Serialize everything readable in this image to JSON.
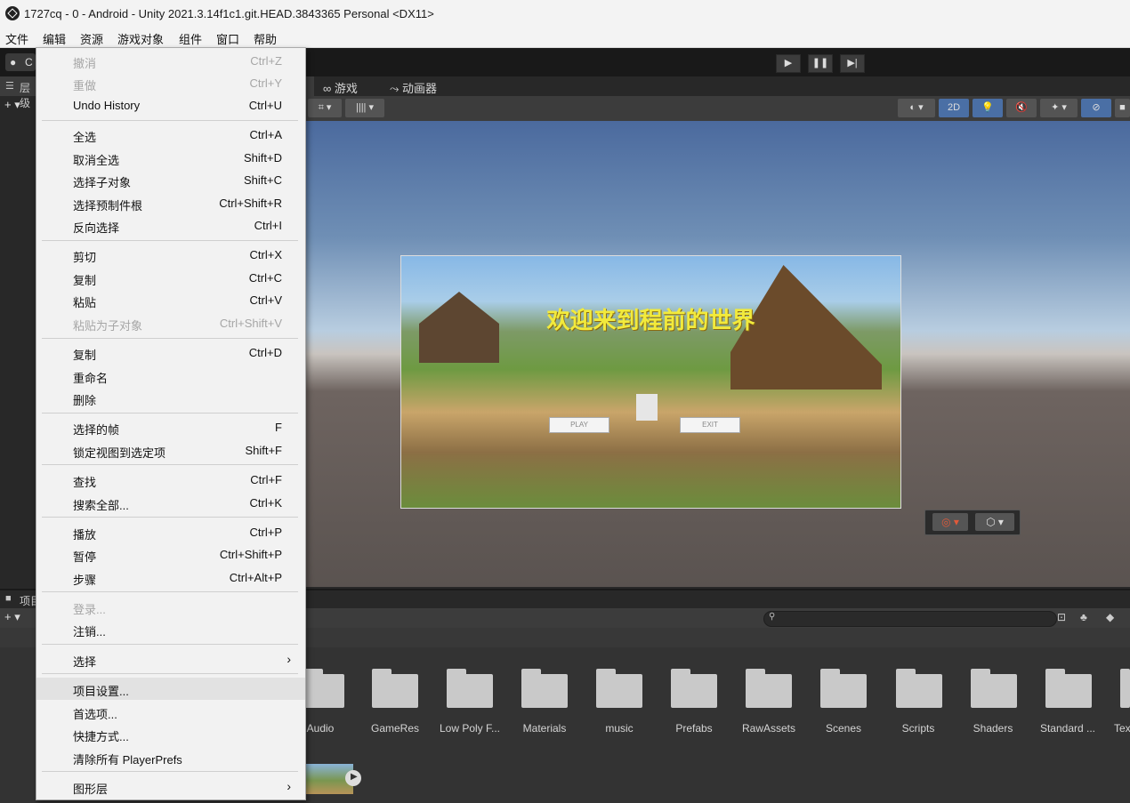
{
  "window": {
    "title": "1727cq - 0 - Android - Unity 2021.3.14f1c1.git.HEAD.3843365 Personal <DX11>"
  },
  "menubar": [
    "文件",
    "编辑",
    "资源",
    "游戏对象",
    "组件",
    "窗口",
    "帮助"
  ],
  "toolbar": {
    "account_initial": "C"
  },
  "left_panel": {
    "hierarchy_label": "层级",
    "add_label": "+ ▾"
  },
  "scene_tabs": [
    {
      "label": "游戏",
      "icon": "gamepad-icon"
    },
    {
      "label": "动画器",
      "icon": "animator-icon"
    }
  ],
  "scene_toolbar": {
    "mode_2d": "2D"
  },
  "game_view": {
    "title": "欢迎来到程前的世界",
    "play_button": "PLAY",
    "exit_button": "EXIT"
  },
  "project": {
    "tab_label": "项目",
    "add_label": "+ ▾"
  },
  "folders": [
    "Audio",
    "GameRes",
    "Low Poly F...",
    "Materials",
    "music",
    "Prefabs",
    "RawAssets",
    "Scenes",
    "Scripts",
    "Shaders",
    "Standard ...",
    "Tex"
  ],
  "edit_menu": {
    "items": [
      {
        "label": "撤消",
        "shortcut": "Ctrl+Z",
        "disabled": true
      },
      {
        "label": "重做",
        "shortcut": "Ctrl+Y",
        "disabled": true
      },
      {
        "label": "Undo History",
        "shortcut": "Ctrl+U"
      },
      {
        "label": "全选",
        "shortcut": "Ctrl+A"
      },
      {
        "label": "取消全选",
        "shortcut": "Shift+D"
      },
      {
        "label": "选择子对象",
        "shortcut": "Shift+C"
      },
      {
        "label": "选择预制件根",
        "shortcut": "Ctrl+Shift+R"
      },
      {
        "label": "反向选择",
        "shortcut": "Ctrl+I"
      },
      {
        "label": "剪切",
        "shortcut": "Ctrl+X"
      },
      {
        "label": "复制",
        "shortcut": "Ctrl+C"
      },
      {
        "label": "粘贴",
        "shortcut": "Ctrl+V"
      },
      {
        "label": "粘贴为子对象",
        "shortcut": "Ctrl+Shift+V",
        "disabled": true
      },
      {
        "label": "复制",
        "shortcut": "Ctrl+D"
      },
      {
        "label": "重命名",
        "shortcut": ""
      },
      {
        "label": "删除",
        "shortcut": ""
      },
      {
        "label": "选择的帧",
        "shortcut": "F"
      },
      {
        "label": "锁定视图到选定项",
        "shortcut": "Shift+F"
      },
      {
        "label": "查找",
        "shortcut": "Ctrl+F"
      },
      {
        "label": "搜索全部...",
        "shortcut": "Ctrl+K"
      },
      {
        "label": "播放",
        "shortcut": "Ctrl+P"
      },
      {
        "label": "暂停",
        "shortcut": "Ctrl+Shift+P"
      },
      {
        "label": "步骤",
        "shortcut": "Ctrl+Alt+P"
      },
      {
        "label": "登录...",
        "shortcut": "",
        "disabled": true
      },
      {
        "label": "注销...",
        "shortcut": ""
      },
      {
        "label": "选择",
        "shortcut": "",
        "submenu": true
      },
      {
        "label": "项目设置...",
        "shortcut": "",
        "highlighted": true
      },
      {
        "label": "首选项...",
        "shortcut": ""
      },
      {
        "label": "快捷方式...",
        "shortcut": ""
      },
      {
        "label": "清除所有 PlayerPrefs",
        "shortcut": ""
      },
      {
        "label": "图形层",
        "shortcut": "",
        "submenu": true
      }
    ]
  }
}
